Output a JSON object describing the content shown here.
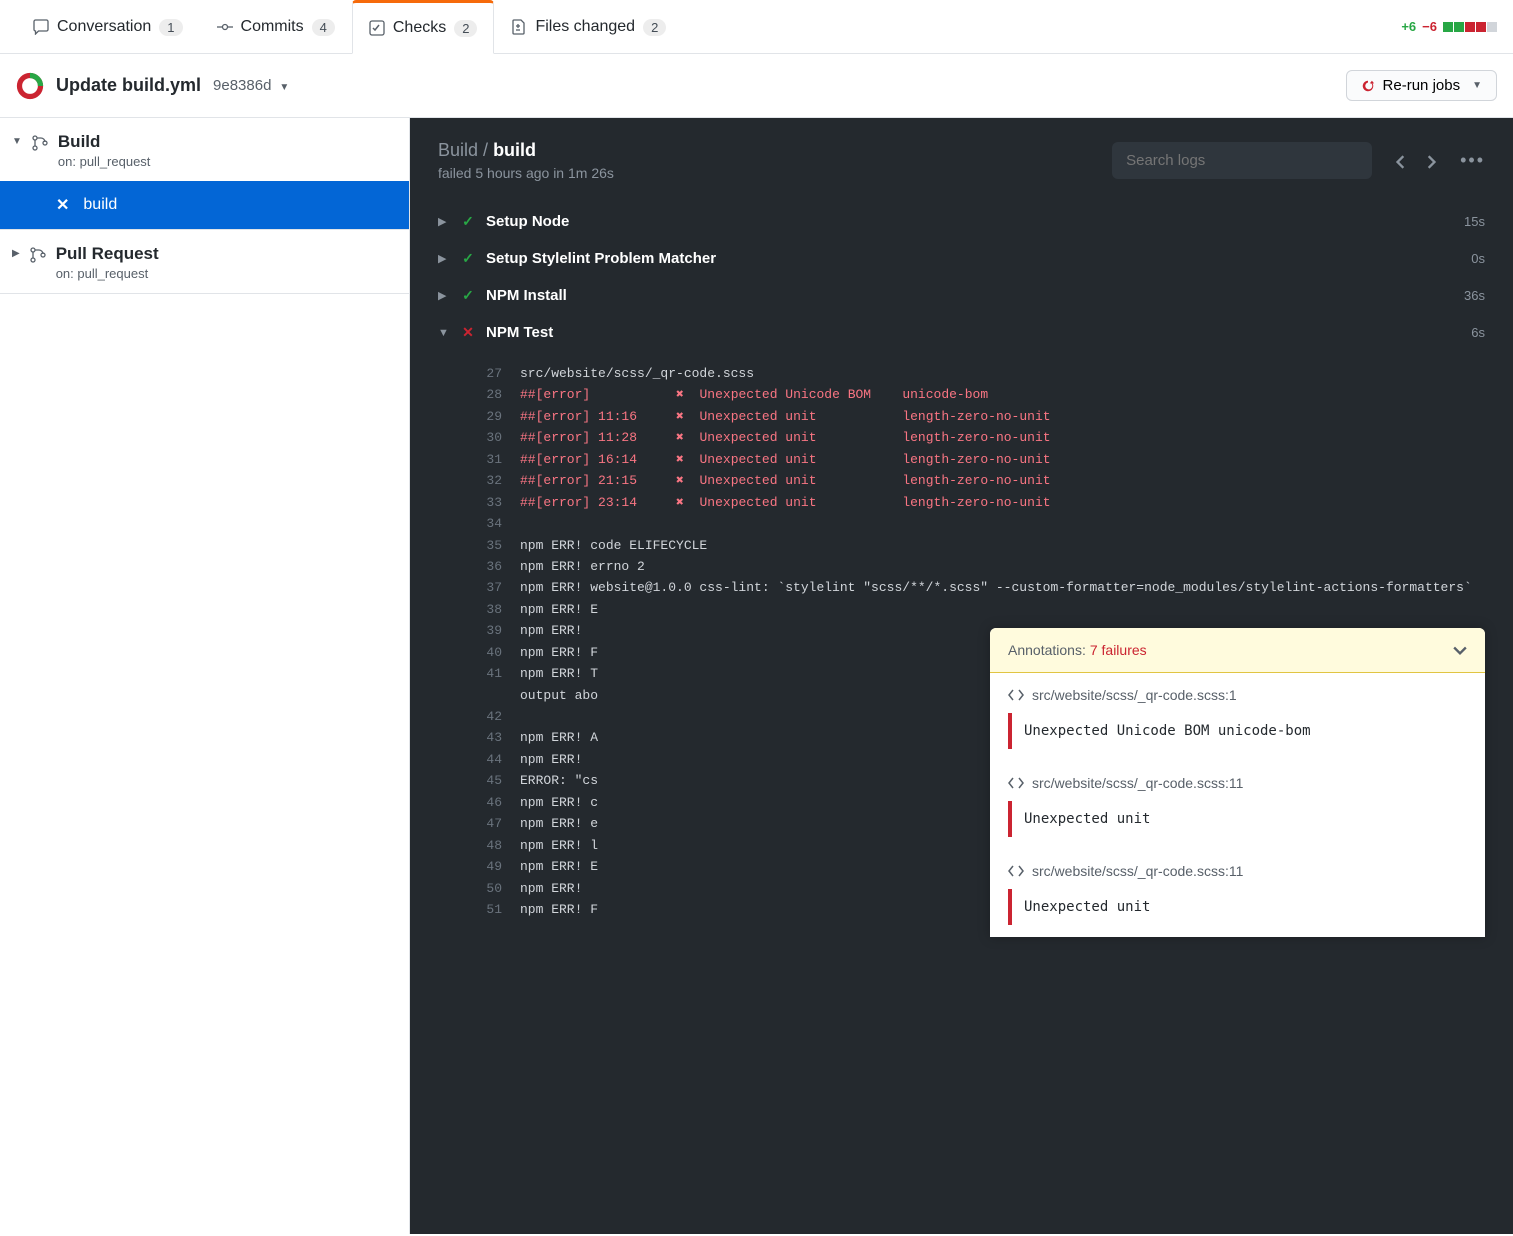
{
  "tabs": {
    "conversation": {
      "label": "Conversation",
      "count": "1"
    },
    "commits": {
      "label": "Commits",
      "count": "4"
    },
    "checks": {
      "label": "Checks",
      "count": "2"
    },
    "files": {
      "label": "Files changed",
      "count": "2"
    }
  },
  "diff": {
    "add": "+6",
    "del": "−6"
  },
  "header": {
    "title": "Update build.yml",
    "sha": "9e8386d",
    "rerun_label": "Re-run jobs"
  },
  "sidebar": {
    "workflows": [
      {
        "name": "Build",
        "sub": "on: pull_request",
        "jobs": [
          {
            "name": "build"
          }
        ]
      },
      {
        "name": "Pull Request",
        "sub": "on: pull_request"
      }
    ]
  },
  "content": {
    "breadcrumb_parent": "Build",
    "breadcrumb_current": "build",
    "status_text": "failed 5 hours ago in 1m 26s",
    "search_placeholder": "Search logs"
  },
  "steps": [
    {
      "name": "Setup Node",
      "status": "ok",
      "duration": "15s",
      "expanded": false
    },
    {
      "name": "Setup Stylelint Problem Matcher",
      "status": "ok",
      "duration": "0s",
      "expanded": false
    },
    {
      "name": "NPM Install",
      "status": "ok",
      "duration": "36s",
      "expanded": false
    },
    {
      "name": "NPM Test",
      "status": "fail",
      "duration": "6s",
      "expanded": true
    }
  ],
  "log": [
    {
      "n": 27,
      "text": "src/website/scss/_qr-code.scss"
    },
    {
      "n": 28,
      "err": true,
      "prefix": "##[error]",
      "loc": "",
      "x": "✖",
      "msg": "Unexpected Unicode BOM",
      "rule": "unicode-bom"
    },
    {
      "n": 29,
      "err": true,
      "prefix": "##[error]",
      "loc": " 11:16",
      "x": "✖",
      "msg": "Unexpected unit",
      "rule": "length-zero-no-unit"
    },
    {
      "n": 30,
      "err": true,
      "prefix": "##[error]",
      "loc": " 11:28",
      "x": "✖",
      "msg": "Unexpected unit",
      "rule": "length-zero-no-unit"
    },
    {
      "n": 31,
      "err": true,
      "prefix": "##[error]",
      "loc": " 16:14",
      "x": "✖",
      "msg": "Unexpected unit",
      "rule": "length-zero-no-unit"
    },
    {
      "n": 32,
      "err": true,
      "prefix": "##[error]",
      "loc": " 21:15",
      "x": "✖",
      "msg": "Unexpected unit",
      "rule": "length-zero-no-unit"
    },
    {
      "n": 33,
      "err": true,
      "prefix": "##[error]",
      "loc": " 23:14",
      "x": "✖",
      "msg": "Unexpected unit",
      "rule": "length-zero-no-unit"
    },
    {
      "n": 34,
      "text": ""
    },
    {
      "n": 35,
      "text": "npm ERR! code ELIFECYCLE"
    },
    {
      "n": 36,
      "text": "npm ERR! errno 2"
    },
    {
      "n": 37,
      "text": "npm ERR! website@1.0.0 css-lint: `stylelint \"scss/**/*.scss\" --custom-formatter=node_modules/stylelint-actions-formatters`"
    },
    {
      "n": 38,
      "text": "npm ERR! E"
    },
    {
      "n": 39,
      "text": "npm ERR! "
    },
    {
      "n": 40,
      "text": "npm ERR! F"
    },
    {
      "n": 41,
      "text": "npm ERR! T\noutput abo"
    },
    {
      "n": 42,
      "text": ""
    },
    {
      "n": 43,
      "text": "npm ERR! A"
    },
    {
      "n": 44,
      "text": "npm ERR!"
    },
    {
      "n": 45,
      "text": "ERROR: \"cs"
    },
    {
      "n": 46,
      "text": "npm ERR! c"
    },
    {
      "n": 47,
      "text": "npm ERR! e"
    },
    {
      "n": 48,
      "text": "npm ERR! l"
    },
    {
      "n": 49,
      "text": "npm ERR! E"
    },
    {
      "n": 50,
      "text": "npm ERR! "
    },
    {
      "n": 51,
      "text": "npm ERR! F"
    }
  ],
  "annotations": {
    "label": "Annotations:",
    "fail_text": "7 failures",
    "items": [
      {
        "file": "src/website/scss/_qr-code.scss:1",
        "msg": "Unexpected Unicode BOM   unicode-bom"
      },
      {
        "file": "src/website/scss/_qr-code.scss:11",
        "msg": "Unexpected unit"
      },
      {
        "file": "src/website/scss/_qr-code.scss:11",
        "msg": "Unexpected unit"
      }
    ]
  }
}
